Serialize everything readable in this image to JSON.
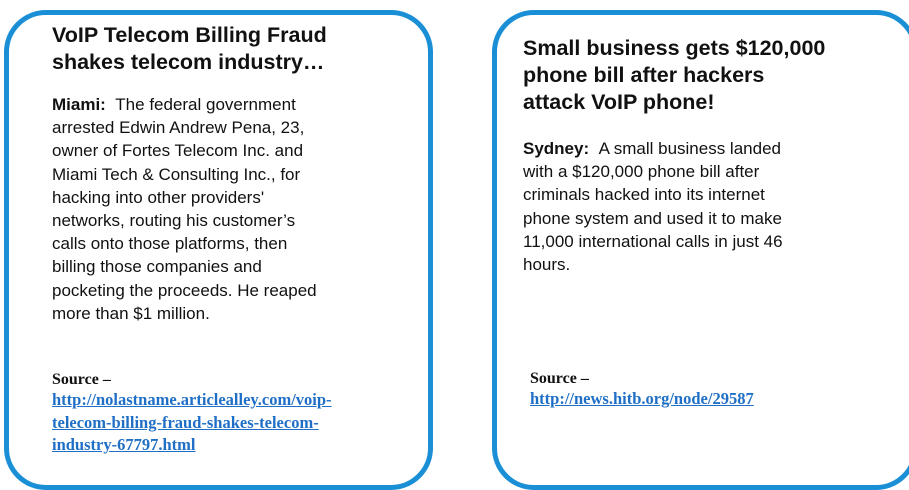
{
  "colors": {
    "border": "#1a8fd6",
    "link": "#1f6fc6",
    "text": "#111111"
  },
  "articles": [
    {
      "headline_lines": [
        "VoIP Telecom Billing Fraud",
        "shakes telecom industry…"
      ],
      "dateline": "Miami:",
      "body_lines": [
        "The federal government",
        "arrested Edwin Andrew Pena, 23,",
        "owner of Fortes Telecom Inc. and",
        "Miami Tech & Consulting Inc., for",
        "hacking into other providers'",
        "networks, routing his customer’s",
        "calls onto those platforms, then",
        "billing those companies and",
        "pocketing the proceeds. He reaped",
        "more than $1 million."
      ],
      "source_label": "Source –",
      "source_link_lines": [
        "http://nolastname.articlealley.com/voip-",
        "telecom-billing-fraud-shakes-telecom-",
        "industry-67797.html"
      ]
    },
    {
      "headline_lines": [
        "Small business gets $120,000",
        "phone bill after hackers",
        "attack VoIP phone!"
      ],
      "dateline": "Sydney:",
      "body_lines": [
        "A small business landed",
        "with a $120,000 phone bill after",
        "criminals hacked into its internet",
        "phone system and used it to make",
        "11,000 international calls in just 46",
        "hours."
      ],
      "source_label": "Source –",
      "source_link_lines": [
        "http://news.hitb.org/node/29587"
      ]
    }
  ]
}
